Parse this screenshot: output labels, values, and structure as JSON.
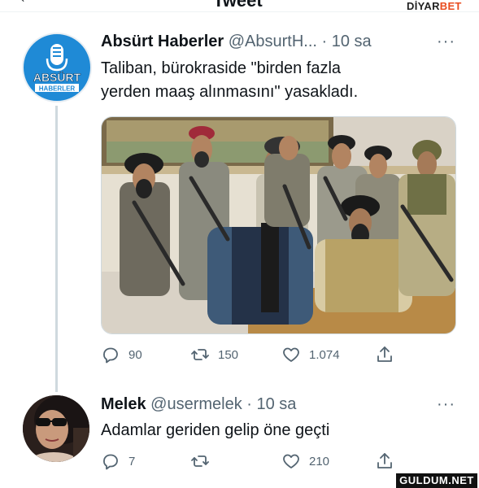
{
  "header": {
    "title": "Tweet",
    "back_icon": "arrow-left-icon"
  },
  "watermark_top": {
    "part1": "DİYAR",
    "part2": "BET"
  },
  "tweet1": {
    "avatar_text": "ABSÜRT",
    "avatar_subtext": "HABERLER",
    "name": "Absürt Haberler",
    "handle_time": "@AbsurtH... · 10 sa",
    "more": "···",
    "text_line1": "Taliban, bürokraside \"birden fazla",
    "text_line2": "yerden maaş alınmasını\" yasakladı.",
    "actions": {
      "replies": "90",
      "retweets": "150",
      "likes": "1.074"
    }
  },
  "tweet2": {
    "name": "Melek",
    "handle_time": "@usermelek · 10 sa",
    "more": "···",
    "text": "Adamlar geriden gelip öne geçti",
    "actions": {
      "replies": "7",
      "retweets": "",
      "likes": "210"
    }
  },
  "watermark_bottom": "GULDUM.NET",
  "colors": {
    "text": "#0f1419",
    "secondary": "#536471",
    "thread_line": "#cfd9de",
    "avatar_blue": "#1f8ad6"
  }
}
